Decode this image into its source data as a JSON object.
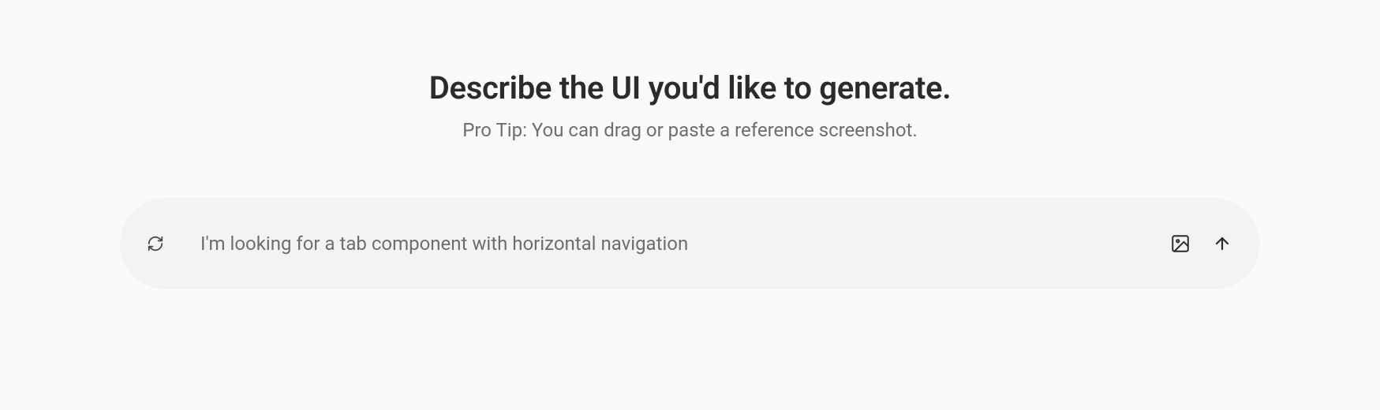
{
  "heading": "Describe the UI you'd like to generate.",
  "subheading": "Pro Tip: You can drag or paste a reference screenshot.",
  "prompt": {
    "placeholder": "I'm looking for a tab component with horizontal navigation",
    "value": ""
  }
}
